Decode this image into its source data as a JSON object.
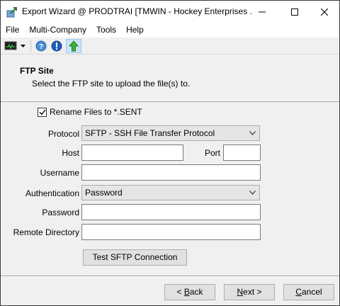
{
  "window": {
    "title": "Export Wizard @ PRODTRAI [TMWIN - Hockey Enterprises ..."
  },
  "menu": {
    "items": [
      {
        "label": "File"
      },
      {
        "label": "Multi-Company"
      },
      {
        "label": "Tools"
      },
      {
        "label": "Help"
      }
    ]
  },
  "header": {
    "title": "FTP Site",
    "subtitle": "Select the FTP site to upload the file(s) to."
  },
  "form": {
    "rename_label": "Rename Files to *.SENT",
    "rename_checked": true,
    "protocol_label": "Protocol",
    "protocol_value": "SFTP - SSH File Transfer Protocol",
    "host_label": "Host",
    "host_value": "",
    "port_label": "Port",
    "port_value": "",
    "username_label": "Username",
    "username_value": "",
    "auth_label": "Authentication",
    "auth_value": "Password",
    "password_label": "Password",
    "password_value": "",
    "remote_dir_label": "Remote Directory",
    "remote_dir_value": "",
    "test_button": "Test SFTP Connection"
  },
  "footer": {
    "back_prefix": "< ",
    "back_key": "B",
    "back_rest": "ack",
    "next_key": "N",
    "next_rest": "ext >",
    "cancel_key": "C",
    "cancel_rest": "ancel"
  },
  "colors": {
    "window_bg": "#f0f0f0",
    "info_icon_blue": "#1f5fbf",
    "up_arrow_green": "#3cb43c"
  }
}
